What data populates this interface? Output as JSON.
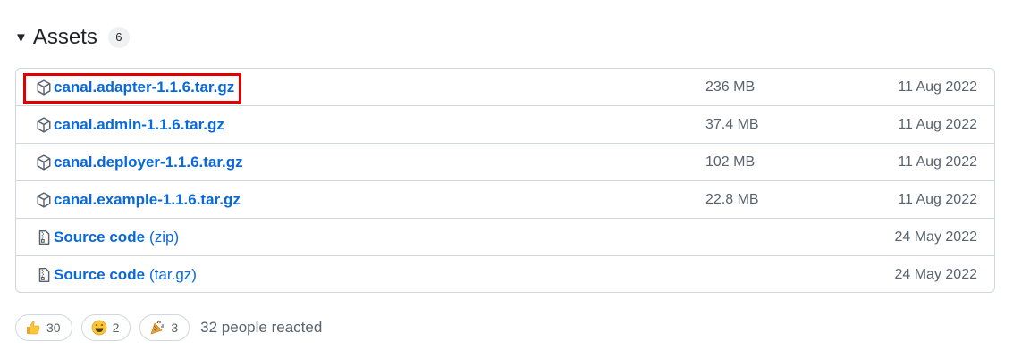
{
  "assets": {
    "title": "Assets",
    "count": "6",
    "items": [
      {
        "name": "canal.adapter-1.1.6.tar.gz",
        "suffix": "",
        "icon": "package-icon",
        "size": "236 MB",
        "date": "11 Aug 2022"
      },
      {
        "name": "canal.admin-1.1.6.tar.gz",
        "suffix": "",
        "icon": "package-icon",
        "size": "37.4 MB",
        "date": "11 Aug 2022"
      },
      {
        "name": "canal.deployer-1.1.6.tar.gz",
        "suffix": "",
        "icon": "package-icon",
        "size": "102 MB",
        "date": "11 Aug 2022"
      },
      {
        "name": "canal.example-1.1.6.tar.gz",
        "suffix": "",
        "icon": "package-icon",
        "size": "22.8 MB",
        "date": "11 Aug 2022"
      },
      {
        "name": "Source code",
        "suffix": "(zip)",
        "icon": "file-zip-icon",
        "size": "",
        "date": "24 May 2022"
      },
      {
        "name": "Source code",
        "suffix": "(tar.gz)",
        "icon": "file-zip-icon",
        "size": "",
        "date": "24 May 2022"
      }
    ]
  },
  "reactions": {
    "items": [
      {
        "icon": "thumbs-up-icon",
        "count": "30"
      },
      {
        "icon": "laugh-icon",
        "count": "2"
      },
      {
        "icon": "tada-icon",
        "count": "3"
      }
    ],
    "summary": "32 people reacted"
  },
  "colors": {
    "link": "#0969da",
    "muted": "#59636e",
    "border": "#d0d7de",
    "highlight": "#e00000"
  }
}
